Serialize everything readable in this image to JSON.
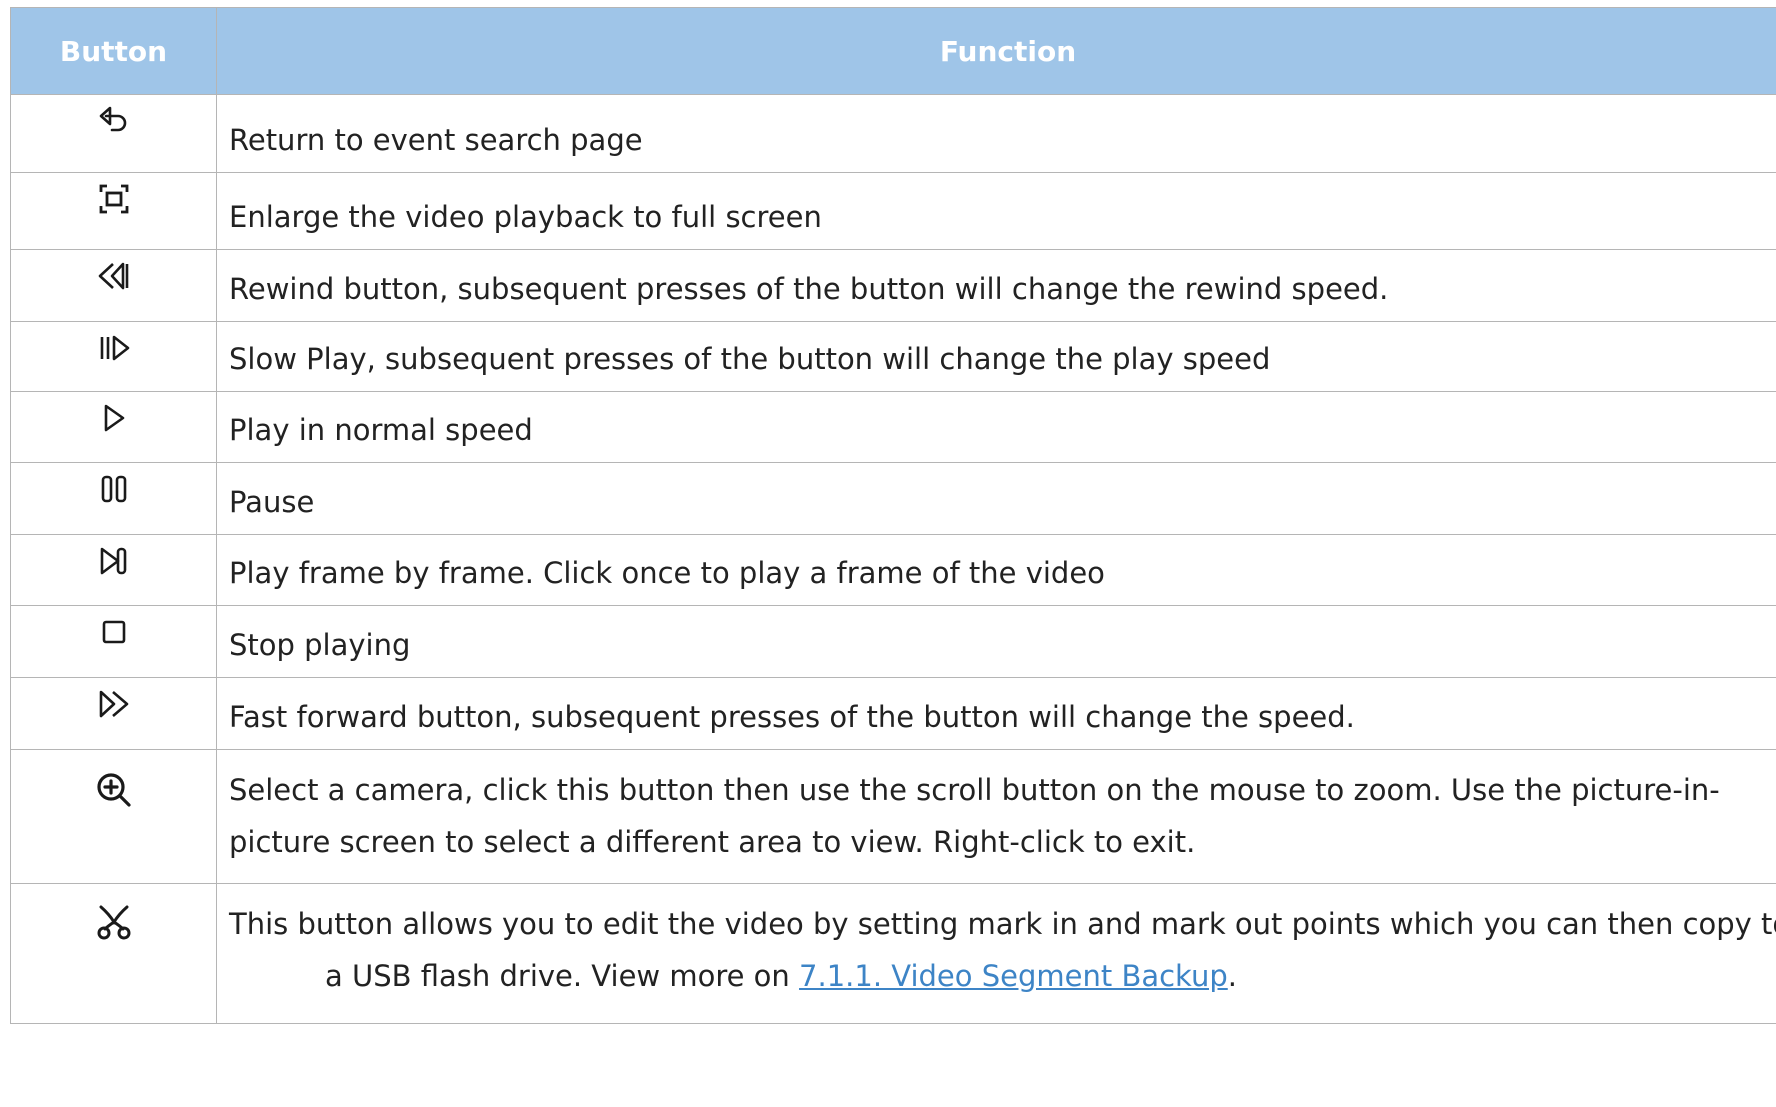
{
  "header": {
    "button": "Button",
    "function": "Function"
  },
  "rows": [
    {
      "icon": "return-icon",
      "text": "Return to event search page"
    },
    {
      "icon": "fullscreen-icon",
      "text": "Enlarge the video playback to full screen"
    },
    {
      "icon": "rewind-icon",
      "text": "Rewind button, subsequent presses of the button will change the rewind speed."
    },
    {
      "icon": "slow-play-icon",
      "text": "Slow Play, subsequent presses of the button will change the play speed"
    },
    {
      "icon": "play-icon",
      "text": "Play in normal speed"
    },
    {
      "icon": "pause-icon",
      "text": "Pause"
    },
    {
      "icon": "frame-step-icon",
      "text": "Play frame by frame. Click once to play a frame of the video"
    },
    {
      "icon": "stop-icon",
      "text": "Stop playing"
    },
    {
      "icon": "fast-forward-icon",
      "text": "Fast forward button, subsequent presses of the button will change the speed."
    },
    {
      "icon": "zoom-in-icon",
      "text_line1": "Select a camera, click this button then use the scroll button on the mouse to zoom. Use the picture-in-",
      "text_line2": "picture screen to select a different area to view. Right-click to exit."
    },
    {
      "icon": "scissors-icon",
      "text_line1": "This button allows you to edit the video by setting mark in and mark out points which you can then copy to",
      "text_line2_prefix": "a USB flash drive. View more on ",
      "link_text": "7.1.1. Video Segment Backup",
      "text_line2_suffix": "."
    }
  ],
  "colors": {
    "header_bg": "#9fc5e8",
    "header_text": "#ffffff",
    "border": "#b5b5b5",
    "link": "#3d84c6",
    "icon": "#1a1a1a"
  }
}
